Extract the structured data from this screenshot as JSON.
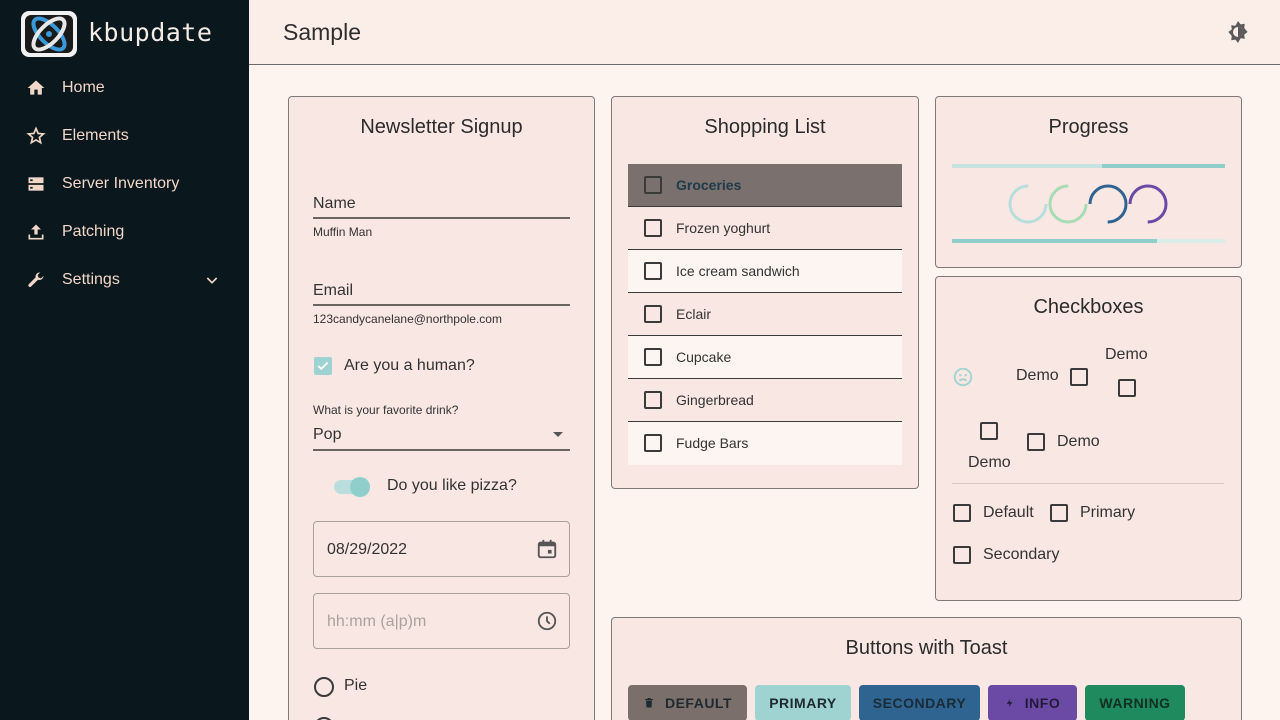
{
  "app": {
    "name": "kbupdate"
  },
  "sidebar": {
    "items": [
      {
        "label": "Home",
        "icon": "home-icon"
      },
      {
        "label": "Elements",
        "icon": "star-icon"
      },
      {
        "label": "Server Inventory",
        "icon": "server-icon"
      },
      {
        "label": "Patching",
        "icon": "upload-icon"
      },
      {
        "label": "Settings",
        "icon": "wrench-icon"
      }
    ]
  },
  "header": {
    "title": "Sample"
  },
  "newsletter": {
    "title": "Newsletter Signup",
    "name_label": "Name",
    "name_value": "Muffin Man",
    "email_label": "Email",
    "email_value": "123candycanelane@northpole.com",
    "human_label": "Are you a human?",
    "human_checked": true,
    "drink_label": "What is your favorite drink?",
    "drink_value": "Pop",
    "pizza_label": "Do you like pizza?",
    "pizza_on": true,
    "date_value": "08/29/2022",
    "time_placeholder": "hh:mm (a|p)m",
    "radio_pie": "Pie"
  },
  "shopping": {
    "title": "Shopping List",
    "items": [
      "Groceries",
      "Frozen yoghurt",
      "Ice cream sandwich",
      "Eclair",
      "Cupcake",
      "Gingerbread",
      "Fudge Bars"
    ]
  },
  "progress": {
    "title": "Progress",
    "top_bar": 0.45,
    "bottom_bar": 0.75
  },
  "checkboxes": {
    "title": "Checkboxes",
    "demo1": "Demo",
    "demo2": "Demo",
    "demo3": "Demo",
    "demo4": "Demo",
    "default": "Default",
    "primary": "Primary",
    "secondary": "Secondary"
  },
  "buttons": {
    "title": "Buttons with Toast",
    "default": "DEFAULT",
    "primary": "PRIMARY",
    "secondary": "SECONDARY",
    "info": "INFO",
    "warning": "WARNING"
  },
  "colors": {
    "sidebar": "#0a171c",
    "accent": "#9ed3d1",
    "secondary": "#2f6490",
    "info": "#6b4aa6",
    "warning": "#1e8a5e",
    "default_btn": "#7b6f6c"
  }
}
